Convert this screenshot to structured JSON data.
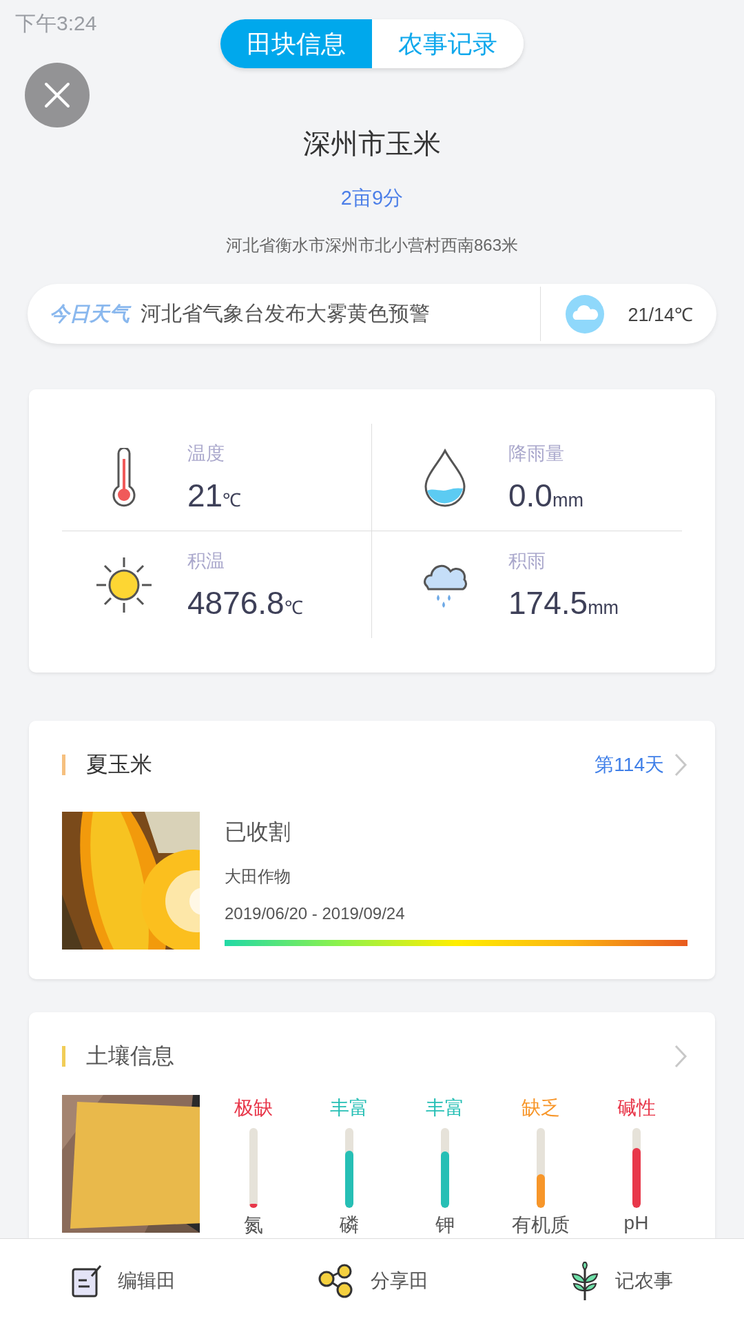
{
  "status_bar": {
    "time": "下午3:24"
  },
  "tabs": [
    {
      "label": "田块信息",
      "selected": true
    },
    {
      "label": "农事记录",
      "selected": false
    }
  ],
  "field": {
    "name": "深州市玉米",
    "area": "2亩9分",
    "address": "河北省衡水市深州市北小营村西南863米"
  },
  "weather": {
    "label": "今日天气",
    "alert": "河北省气象台发布大雾黄色预警",
    "temperature": "21/14℃"
  },
  "metrics": [
    {
      "kind": "temperature",
      "label": "温度",
      "value": "21",
      "unit": "℃"
    },
    {
      "kind": "rainfall",
      "label": "降雨量",
      "value": "0.0",
      "unit": "mm"
    },
    {
      "kind": "accumulated_temperature",
      "label": "积温",
      "value": "4876.8",
      "unit": "℃"
    },
    {
      "kind": "accumulated_rain",
      "label": "积雨",
      "value": "174.5",
      "unit": "mm"
    }
  ],
  "crop": {
    "title": "夏玉米",
    "day": "第114天",
    "status": "已收割",
    "category": "大田作物",
    "period": "2019/06/20 - 2019/09/24"
  },
  "soil": {
    "title": "土壤信息",
    "items": [
      {
        "status": "极缺",
        "name": "氮",
        "level": 0.05,
        "color": "#e8374a"
      },
      {
        "status": "丰富",
        "name": "磷",
        "level": 0.72,
        "color": "#26bfb5"
      },
      {
        "status": "丰富",
        "name": "钾",
        "level": 0.71,
        "color": "#26bfb5"
      },
      {
        "status": "缺乏",
        "name": "有机质",
        "level": 0.42,
        "color": "#f7962a"
      },
      {
        "status": "碱性",
        "name": "pH",
        "level": 0.75,
        "color": "#e8374a"
      }
    ]
  },
  "bottom_nav": [
    {
      "kind": "edit",
      "label": "编辑田"
    },
    {
      "kind": "share",
      "label": "分享田"
    },
    {
      "kind": "record",
      "label": "记农事"
    }
  ]
}
